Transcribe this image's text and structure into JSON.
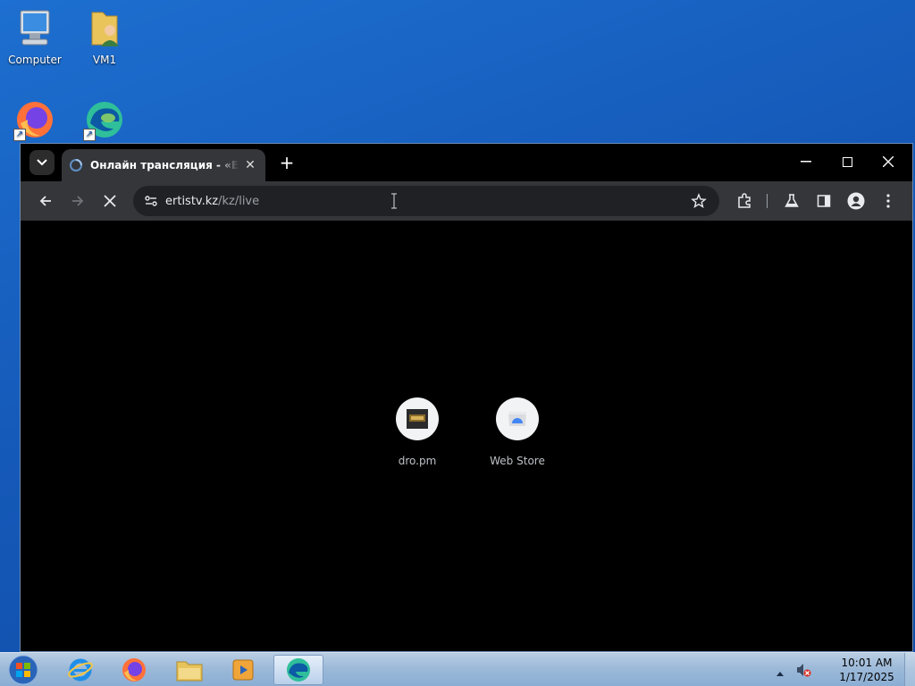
{
  "desktop": {
    "icons": [
      {
        "label": "Computer"
      },
      {
        "label": "VM1"
      },
      {
        "label": ""
      },
      {
        "label": ""
      }
    ]
  },
  "browser": {
    "tab": {
      "title": "Онлайн трансляция - «ERTIS»"
    },
    "address": {
      "host": "ertistv.kz",
      "path": "/kz/live"
    },
    "shortcuts": [
      {
        "label": "dro.pm"
      },
      {
        "label": "Web Store"
      }
    ]
  },
  "taskbar": {
    "clock": {
      "time": "10:01 AM",
      "date": "1/17/2025"
    }
  },
  "colors": {
    "desktop_bg": "#1559b8",
    "browser_frame": "#000000",
    "toolbar": "#35363a",
    "omnibox": "#202124"
  }
}
